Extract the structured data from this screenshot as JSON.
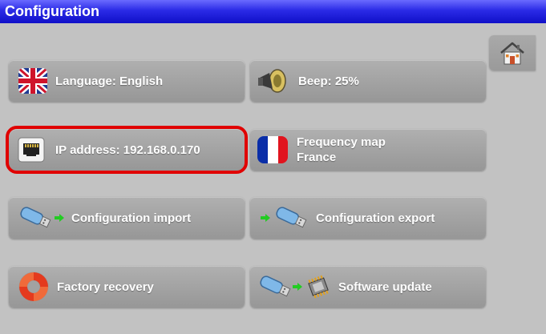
{
  "window": {
    "title": "Configuration"
  },
  "buttons": {
    "language": "Language: English",
    "beep": "Beep: 25%",
    "ip_address": "IP address: 192.168.0.170",
    "frequency_map_line1": "Frequency map",
    "frequency_map_line2": "France",
    "config_import": "Configuration import",
    "config_export": "Configuration export",
    "factory_recovery": "Factory recovery",
    "software_update": "Software update"
  },
  "selected": "ip-address-button",
  "colors": {
    "title_bar": "#1a1ad8",
    "background": "#c2c2c2",
    "button": "#a2a2a2",
    "selection": "#e00000"
  },
  "icons": [
    "home-icon",
    "uk-flag-icon",
    "speaker-icon",
    "ethernet-port-icon",
    "france-flag-icon",
    "usb-stick-icon",
    "green-arrow-icon",
    "lifebuoy-icon",
    "chip-icon"
  ]
}
